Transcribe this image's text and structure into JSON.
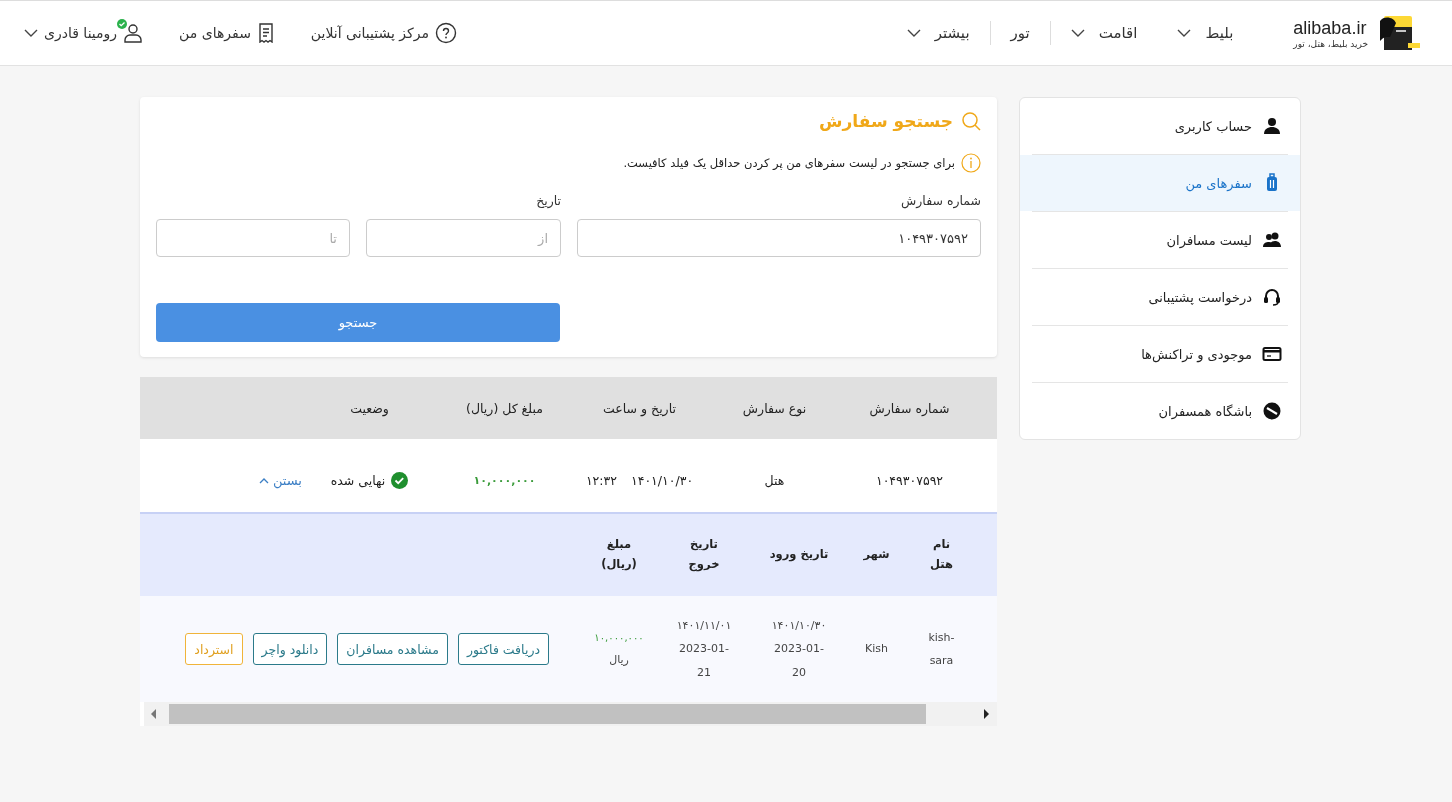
{
  "header": {
    "logo": {
      "brand": "alibaba.ir",
      "tagline": "خرید بلیط، هتل، تور"
    },
    "nav": [
      {
        "label": "بلیط",
        "dropdown": true
      },
      {
        "label": "اقامت",
        "dropdown": true
      },
      {
        "label": "تور",
        "dropdown": false
      },
      {
        "label": "بیشتر",
        "dropdown": true
      }
    ],
    "support": "مرکز پشتیبانی آنلاین",
    "trips": "سفرهای من",
    "user": {
      "name": "رومینا قادری",
      "verified": true
    }
  },
  "sidebar": {
    "items": [
      {
        "label": "حساب کاربری",
        "kind": "user",
        "selected": false
      },
      {
        "label": "سفرهای من",
        "kind": "suitcase",
        "selected": true
      },
      {
        "label": "لیست مسافران",
        "kind": "users",
        "selected": false
      },
      {
        "label": "درخواست پشتیبانی",
        "kind": "headset",
        "selected": false
      },
      {
        "label": "موجودی و تراکنش‌ها",
        "kind": "card",
        "selected": false
      },
      {
        "label": "باشگاه همسفران",
        "kind": "club",
        "selected": false
      }
    ]
  },
  "search": {
    "title": "جستجو سفارش",
    "hint": "برای جستجو در لیست سفرهای من پر کردن حداقل یک فیلد کافیست.",
    "order_label": "شماره سفارش",
    "order_value": "۱۰۴۹۳۰۷۵۹۲",
    "date_label": "تاریخ",
    "from_placeholder": "از",
    "to_placeholder": "تا",
    "button": "جستجو"
  },
  "orders": {
    "columns": [
      "شماره سفارش",
      "نوع سفارش",
      "تاریخ و ساعت",
      "مبلغ کل (ریال)",
      "وضعیت"
    ],
    "rows": [
      {
        "order_number": "۱۰۴۹۳۰۷۵۹۲",
        "type": "هتل",
        "date": "۱۴۰۱/۱۰/۳۰",
        "time": "۱۲:۳۲",
        "amount": "۱۰,۰۰۰,۰۰۰",
        "status": "نهایی شده",
        "done": true,
        "toggle": "بستن",
        "expanded": true,
        "details": {
          "columns": [
            "نام هتل",
            "شهر",
            "تاریخ ورود",
            "تاریخ خروج",
            "مبلغ (ریال)"
          ],
          "rows": [
            {
              "hotel": "kish-sara",
              "city": "Kish",
              "checkin": [
                "۱۴۰۱/۱۰/۳۰",
                "2023-01-20"
              ],
              "checkout": [
                "۱۴۰۱/۱۱/۰۱",
                "2023-01-21"
              ],
              "amount": "۱۰,۰۰۰,۰۰۰",
              "currency": "ریال",
              "actions": [
                {
                  "label": "دریافت فاکتور",
                  "kind": "primary"
                },
                {
                  "label": "مشاهده مسافران",
                  "kind": "primary"
                },
                {
                  "label": "دانلود واچر",
                  "kind": "primary"
                },
                {
                  "label": "استرداد",
                  "kind": "warning"
                }
              ]
            }
          ]
        }
      }
    ]
  }
}
